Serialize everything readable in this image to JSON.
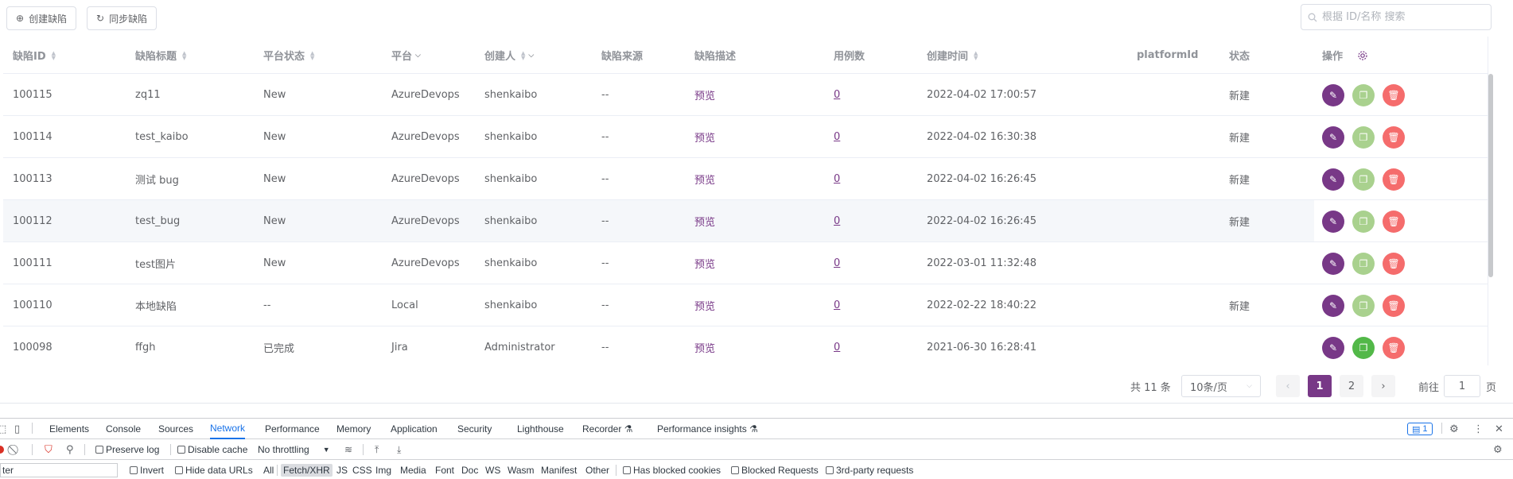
{
  "toolbar": {
    "create_label": "创建缺陷",
    "sync_label": "同步缺陷",
    "search_placeholder": "根据 ID/名称 搜索"
  },
  "table": {
    "headers": {
      "id": "缺陷ID",
      "title": "缺陷标题",
      "platform_status": "平台状态",
      "platform": "平台",
      "creator": "创建人",
      "source": "缺陷来源",
      "description": "缺陷描述",
      "case_count": "用例数",
      "create_time": "创建时间",
      "platform_id": "platformId",
      "status": "状态",
      "operations": "操作"
    },
    "rows": [
      {
        "id": "100115",
        "title": "zq11",
        "platform_status": "New",
        "platform": "AzureDevops",
        "creator": "shenkaibo",
        "source": "--",
        "description": "预览",
        "case_count": "0",
        "create_time": "2022-04-02 17:00:57",
        "platform_id": "",
        "status": "新建"
      },
      {
        "id": "100114",
        "title": "test_kaibo",
        "platform_status": "New",
        "platform": "AzureDevops",
        "creator": "shenkaibo",
        "source": "--",
        "description": "预览",
        "case_count": "0",
        "create_time": "2022-04-02 16:30:38",
        "platform_id": "",
        "status": "新建"
      },
      {
        "id": "100113",
        "title": "测试 bug",
        "platform_status": "New",
        "platform": "AzureDevops",
        "creator": "shenkaibo",
        "source": "--",
        "description": "预览",
        "case_count": "0",
        "create_time": "2022-04-02 16:26:45",
        "platform_id": "",
        "status": "新建"
      },
      {
        "id": "100112",
        "title": "test_bug",
        "platform_status": "New",
        "platform": "AzureDevops",
        "creator": "shenkaibo",
        "source": "--",
        "description": "预览",
        "case_count": "0",
        "create_time": "2022-04-02 16:26:45",
        "platform_id": "",
        "status": "新建"
      },
      {
        "id": "100111",
        "title": "test图片",
        "platform_status": "New",
        "platform": "AzureDevops",
        "creator": "shenkaibo",
        "source": "--",
        "description": "预览",
        "case_count": "0",
        "create_time": "2022-03-01 11:32:48",
        "platform_id": "",
        "status": ""
      },
      {
        "id": "100110",
        "title": "本地缺陷",
        "platform_status": "--",
        "platform": "Local",
        "creator": "shenkaibo",
        "source": "--",
        "description": "预览",
        "case_count": "0",
        "create_time": "2022-02-22 18:40:22",
        "platform_id": "",
        "status": "新建"
      },
      {
        "id": "100098",
        "title": "ffgh",
        "platform_status": "已完成",
        "platform": "Jira",
        "creator": "Administrator",
        "source": "--",
        "description": "预览",
        "case_count": "0",
        "create_time": "2021-06-30 16:28:41",
        "platform_id": "",
        "status": ""
      }
    ]
  },
  "pagination": {
    "total": "共 11 条",
    "page_size": "10条/页",
    "pages": [
      "1",
      "2"
    ],
    "current": "1",
    "prev": "‹",
    "next": "›",
    "goto_label": "前往",
    "goto_value": "1",
    "goto_unit": "页"
  },
  "devtools": {
    "tabs": [
      "Elements",
      "Console",
      "Sources",
      "Network",
      "Performance",
      "Memory",
      "Application",
      "Security",
      "Lighthouse",
      "Recorder",
      "Performance insights"
    ],
    "active_tab": "Network",
    "badge_count": "1",
    "preserve_log": "Preserve log",
    "disable_cache": "Disable cache",
    "throttling": "No throttling",
    "filter_value": "ter",
    "invert": "Invert",
    "hide_data_urls": "Hide data URLs",
    "types": [
      "All",
      "Fetch/XHR",
      "JS",
      "CSS",
      "Img",
      "Media",
      "Font",
      "Doc",
      "WS",
      "Wasm",
      "Manifest",
      "Other"
    ],
    "active_type": "Fetch/XHR",
    "has_blocked_cookies": "Has blocked cookies",
    "blocked_requests": "Blocked Requests",
    "third_party": "3rd-party requests"
  },
  "colors": {
    "accent": "#783887",
    "copy_button": "#a9d18e",
    "copy_button_active": "#52b848",
    "delete_button": "#f56c6c",
    "devtools_active": "#1a73e8"
  }
}
